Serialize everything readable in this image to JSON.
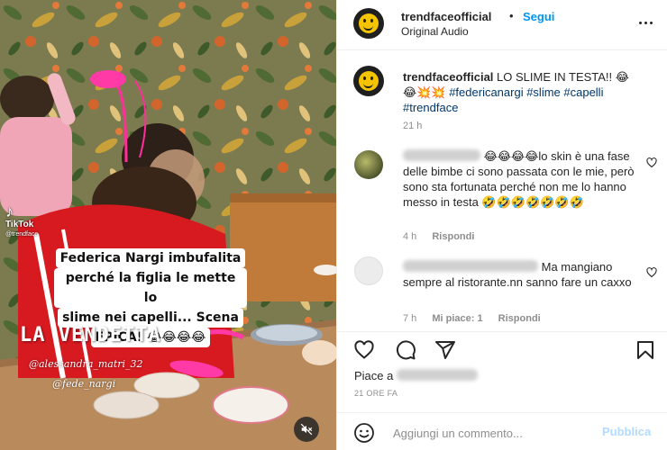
{
  "post": {
    "username": "trendfaceofficial",
    "follow_label": "Segui",
    "separator": "•",
    "audio": "Original Audio",
    "caption_text": "LO SLIME IN TESTA!! 😂😂💥💥",
    "caption_tags": "#federicanargi #slime #capelli #trendface",
    "caption_time": "21 h"
  },
  "media": {
    "tiktok_label": "TikTok",
    "tiktok_handle": "@trendface",
    "overlay_lines": [
      "Federica Nargi imbufalita",
      "perché la figlia le mette lo",
      "slime nei capelli... Scena",
      "EPICA! 😂😂😂😂"
    ],
    "headline": "LA VENDETTA",
    "tag_1": "@alessandra_matri_32",
    "tag_2": "@fede_nargi"
  },
  "comments": [
    {
      "text": "😂😂😂😂lo skin è una fase delle bimbe ci sono passata con le mie, però sono sta fortunata perché non me lo hanno messo in testa 🤣🤣🤣🤣🤣🤣🤣",
      "time": "4 h",
      "reply_label": "Rispondi"
    },
    {
      "text": "Ma mangiano sempre al ristorante.nn sanno fare un caxxo",
      "time": "7 h",
      "likes_label": "Mi piace: 1",
      "reply_label": "Rispondi"
    }
  ],
  "footer": {
    "likes_prefix": "Piace a",
    "date": "21 ORE FA",
    "comment_placeholder": "Aggiungi un commento...",
    "publish_label": "Pubblica"
  },
  "colors": {
    "accent": "#0095f6",
    "publish_disabled": "#b3dbff",
    "hashtag": "#00376b",
    "muted": "#8e8e8e"
  },
  "icons": [
    "more-horizontal-icon",
    "heart-icon",
    "comment-icon",
    "share-icon",
    "bookmark-icon",
    "emoji-icon",
    "mute-icon",
    "tiktok-icon"
  ]
}
